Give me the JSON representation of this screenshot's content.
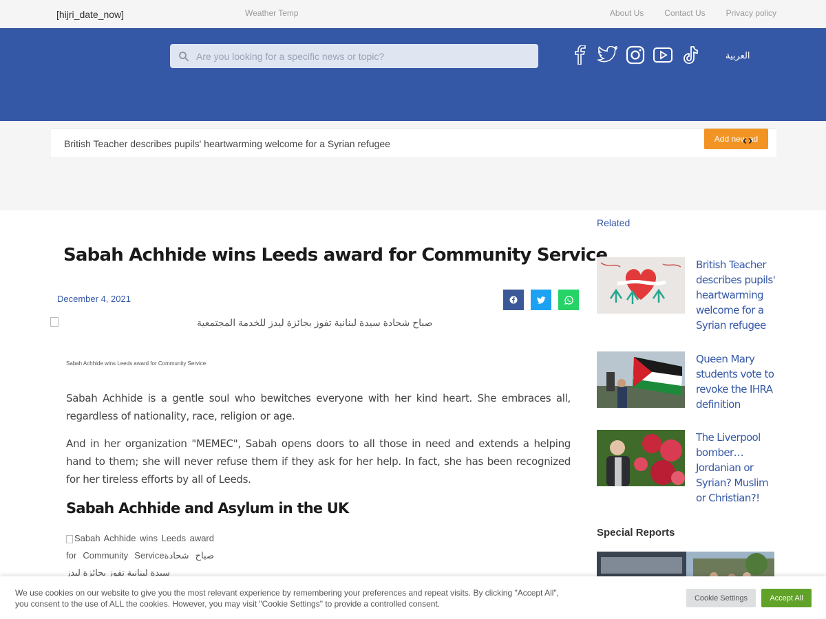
{
  "topbar": {
    "date": "[hijri_date_now]",
    "weather": "Weather Temp",
    "links": [
      "About Us",
      "Contact Us",
      "Privacy policy"
    ]
  },
  "header": {
    "search_placeholder": "Are you looking for a specific news or topic?",
    "social_icons": [
      "facebook-icon",
      "twitter-icon",
      "instagram-icon",
      "youtube-icon",
      "tiktok-icon"
    ],
    "language_link": "العربية",
    "colors": {
      "brand_blue": "#3558a6",
      "accent_orange": "#f29423"
    }
  },
  "ticker": {
    "text": "British Teacher describes pupils' heartwarming welcome for a Syrian refugee",
    "add_button": "Add new ad"
  },
  "article": {
    "title": "Sabah Achhide wins Leeds award for Community Service",
    "date": "December 4, 2021",
    "share_icons": [
      "facebook-icon",
      "twitter-icon",
      "whatsapp-icon"
    ],
    "image_alt": "صباح شحادة سيدة لبنانية تفوز بجائزة ليدز للخدمة المجتمعية",
    "caption": "Sabah Achhide wins Leeds award for Community Service",
    "paragraphs": [
      "Sabah Achhide is a gentle soul who bewitches everyone with her kind heart. She embraces all, regardless of nationality, race, religion or age.",
      "And in her organization \"MEMEC\", Sabah opens doors to all those in need and extends a helping hand to them; she will never refuse them if they ask for her help. In fact, she has been recognized for her tireless efforts by all of Leeds."
    ],
    "subheading": "Sabah Achhide and Asylum in the UK",
    "image2_alt": "Sabah Achhide wins Leeds award for Community Serviceصباح شحادة سيدة لبنانية تفوز بجائزة ليدز"
  },
  "sidebar": {
    "related_heading": "Related",
    "related": [
      {
        "title": "British Teacher describes pupils' heartwarming welcome for a Syrian refugee"
      },
      {
        "title": "Queen Mary students vote to revoke the IHRA definition"
      },
      {
        "title": "The Liverpool bomber… Jordanian or Syrian? Muslim or Christian?!"
      }
    ],
    "special_heading": "Special Reports"
  },
  "cookie": {
    "text": "We use cookies on our website to give you the most relevant experience by remembering your preferences and repeat visits. By clicking \"Accept All\", you consent to the use of ALL the cookies. However, you may visit \"Cookie Settings\" to provide a controlled consent.",
    "settings_button": "Cookie Settings",
    "accept_button": "Accept All",
    "accept_color": "#61a229"
  }
}
